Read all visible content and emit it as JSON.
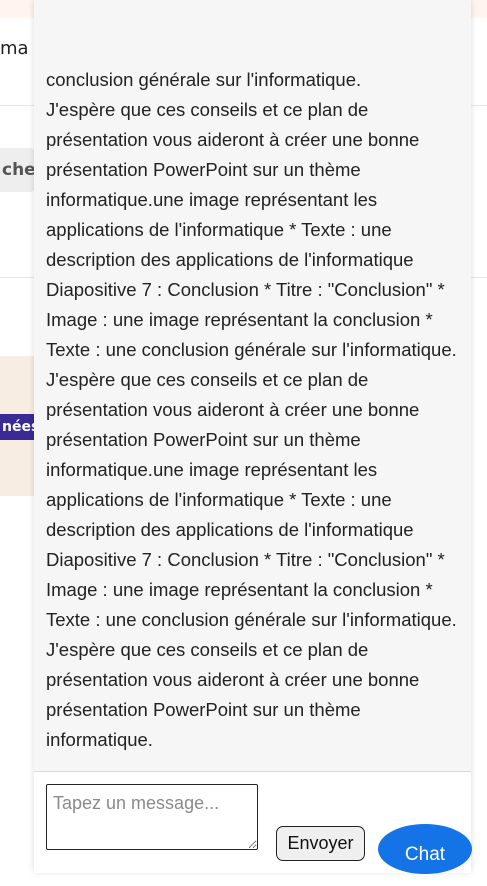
{
  "background": {
    "row_text": "ma",
    "tab_text": "che",
    "badge_text": "nées"
  },
  "chat": {
    "message": "conclusion générale sur l'informatique.\nJ'espère que ces conseils et ce plan de présentation vous aideront à créer une bonne présentation PowerPoint sur un thème informatique.une image représentant les applications de l'informatique * Texte : une description des applications de l'informatique Diapositive 7 : Conclusion * Titre : \"Conclusion\" * Image : une image représentant la conclusion * Texte : une conclusion générale sur l'informatique.\nJ'espère que ces conseils et ce plan de présentation vous aideront à créer une bonne présentation PowerPoint sur un thème informatique.une image représentant les applications de l'informatique * Texte : une description des applications de l'informatique Diapositive 7 : Conclusion * Titre : \"Conclusion\" * Image : une image représentant la conclusion * Texte : une conclusion générale sur l'informatique.\nJ'espère que ces conseils et ce plan de présentation vous aideront à créer une bonne présentation PowerPoint sur un thème informatique.",
    "input_placeholder": "Tapez un message...",
    "input_value": "",
    "send_label": "Envoyer",
    "toggle_label": "Chat"
  },
  "colors": {
    "accent": "#1473e6",
    "badge": "#3a2a93",
    "panel_bg": "#f6f6f6"
  },
  "icons": {
    "resize": "resize-grip-icon"
  }
}
